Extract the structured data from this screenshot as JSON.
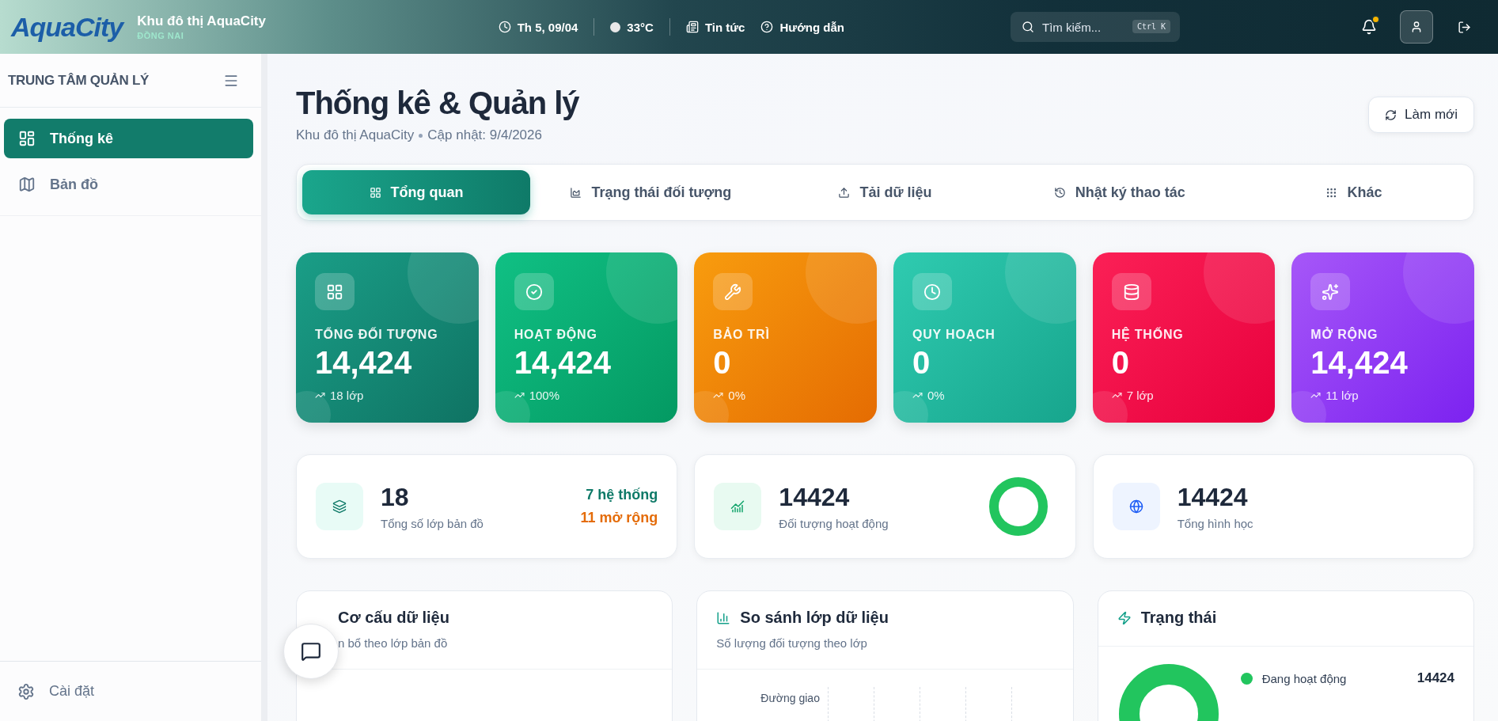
{
  "header": {
    "logo": "AquaCity",
    "title": "Khu đô thị AquaCity",
    "subtitle": "ĐỒNG NAI",
    "date": "Th 5, 09/04",
    "weather": "33°C",
    "links": [
      "Tin tức",
      "Hướng dẫn"
    ],
    "search": {
      "placeholder": "Tìm kiếm...",
      "shortcut": "Ctrl K"
    },
    "notification": true
  },
  "sidebar": {
    "title": "TRUNG TÂM QUẢN LÝ",
    "items": [
      {
        "kind": "stats",
        "label": "Thống kê",
        "selected": true
      },
      {
        "kind": "map",
        "label": "Bản đồ",
        "selected": false
      }
    ],
    "footer": "Cài đặt"
  },
  "page": {
    "title": "Thống kê & Quản lý",
    "subtitle": "Khu đô thị AquaCity",
    "updated": "Cập nhật: 9/4/2026",
    "refresh": "Làm mới"
  },
  "tabs": [
    {
      "kind": "overview",
      "label": "Tổng quan",
      "selected": true
    },
    {
      "kind": "status",
      "label": "Trạng thái đối tượng",
      "selected": false
    },
    {
      "kind": "upload",
      "label": "Tải dữ liệu",
      "selected": false
    },
    {
      "kind": "log",
      "label": "Nhật ký thao tác",
      "selected": false
    },
    {
      "kind": "other",
      "label": "Khác",
      "selected": false
    }
  ],
  "stat_cards": [
    {
      "kind": "total",
      "label": "TỔNG ĐỐI TƯỢNG",
      "value": "14,424",
      "trend": "18 lớp"
    },
    {
      "kind": "active",
      "label": "HOẠT ĐỘNG",
      "value": "14,424",
      "trend": "100%"
    },
    {
      "kind": "maintenance",
      "label": "BẢO TRÌ",
      "value": "0",
      "trend": "0%"
    },
    {
      "kind": "planning",
      "label": "QUY HOẠCH",
      "value": "0",
      "trend": "0%"
    },
    {
      "kind": "system",
      "label": "HỆ THỐNG",
      "value": "0",
      "trend": "7 lớp"
    },
    {
      "kind": "extension",
      "label": "MỞ RỘNG",
      "value": "14,424",
      "trend": "11 lớp"
    }
  ],
  "summary_cards": [
    {
      "kind": "layers",
      "value": "18",
      "label": "Tổng số lớp bản đồ",
      "breakdown": [
        {
          "text": "7 hệ thống",
          "color": "#0f7a68"
        },
        {
          "text": "11 mở rộng",
          "color": "#e46c0a"
        }
      ]
    },
    {
      "kind": "active",
      "value": "14424",
      "label": "Đối tượng hoạt động"
    },
    {
      "kind": "geometry",
      "value": "14424",
      "label": "Tổng hình học"
    }
  ],
  "panels": [
    {
      "kind": "structure",
      "title": "Cơ cấu dữ liệu",
      "subtitle": "n bổ theo lớp bản đồ"
    },
    {
      "kind": "compare",
      "title": "So sánh lớp dữ liệu",
      "subtitle": "Số lượng đối tượng theo lớp",
      "axis_label": "Đường giao"
    },
    {
      "kind": "status",
      "title": "Trạng thái",
      "legend": [
        {
          "label": "Đang hoạt động",
          "value": "14424",
          "color": "#22c55e"
        }
      ]
    }
  ]
}
